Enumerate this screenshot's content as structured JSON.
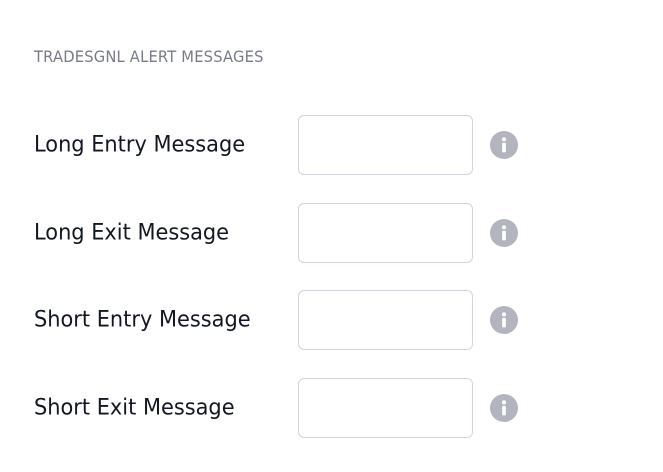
{
  "section": {
    "title": "TRADESGNL ALERT MESSAGES"
  },
  "fields": [
    {
      "label": "Long Entry Message",
      "value": "",
      "info_icon": "info-icon"
    },
    {
      "label": "Long Exit Message",
      "value": "",
      "info_icon": "info-icon"
    },
    {
      "label": "Short Entry Message",
      "value": "",
      "info_icon": "info-icon"
    },
    {
      "label": "Short Exit Message",
      "value": "",
      "info_icon": "info-icon"
    }
  ],
  "colors": {
    "label_text": "#131722",
    "section_title": "#787b86",
    "input_border": "#d1d4dc",
    "info_icon": "#b2b5be"
  }
}
